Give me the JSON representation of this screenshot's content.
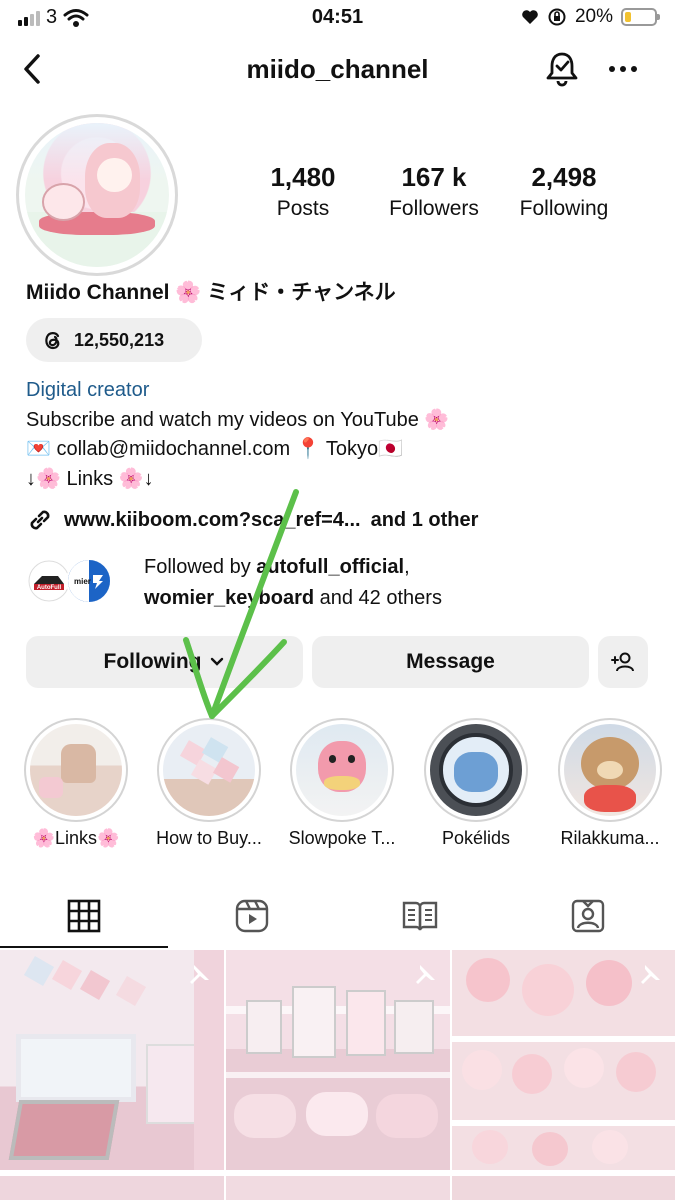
{
  "status_bar": {
    "carrier": "3",
    "time": "04:51",
    "battery": "20%",
    "battery_level": 0.2
  },
  "header": {
    "username": "miido_channel"
  },
  "profile": {
    "stats": [
      {
        "value": "1,480",
        "label": "Posts"
      },
      {
        "value": "167 k",
        "label": "Followers"
      },
      {
        "value": "2,498",
        "label": "Following"
      }
    ],
    "display_name": "Miido Channel 🌸 ミィド・チャンネル",
    "threads_count": "12,550,213",
    "category": "Digital creator",
    "bio_lines": [
      "Subscribe and watch my videos on YouTube 🌸",
      "💌 collab@miidochannel.com 📍 Tokyo🇯🇵",
      "↓🌸 Links 🌸↓"
    ],
    "link": "www.kiiboom.com?sca_ref=4...",
    "link_more": " and 1 other",
    "followed_by": {
      "prefix": "Followed by ",
      "user1": "autofull_official",
      "sep": ",",
      "user2": "womier_keyboard",
      "suffix": " and 42 others"
    }
  },
  "actions": {
    "following": "Following",
    "message": "Message"
  },
  "highlights": [
    {
      "label": "🌸Links🌸"
    },
    {
      "label": "How to Buy..."
    },
    {
      "label": "Slowpoke T..."
    },
    {
      "label": "Pokélids"
    },
    {
      "label": "Rilakkuma..."
    }
  ],
  "tabs": [
    "grid-icon",
    "reels-icon",
    "guide-icon",
    "tagged-icon"
  ],
  "colors": {
    "accent_link": "#1f5b8b",
    "annotation_arrow": "#5cc04a",
    "button_bg": "#efefef"
  }
}
